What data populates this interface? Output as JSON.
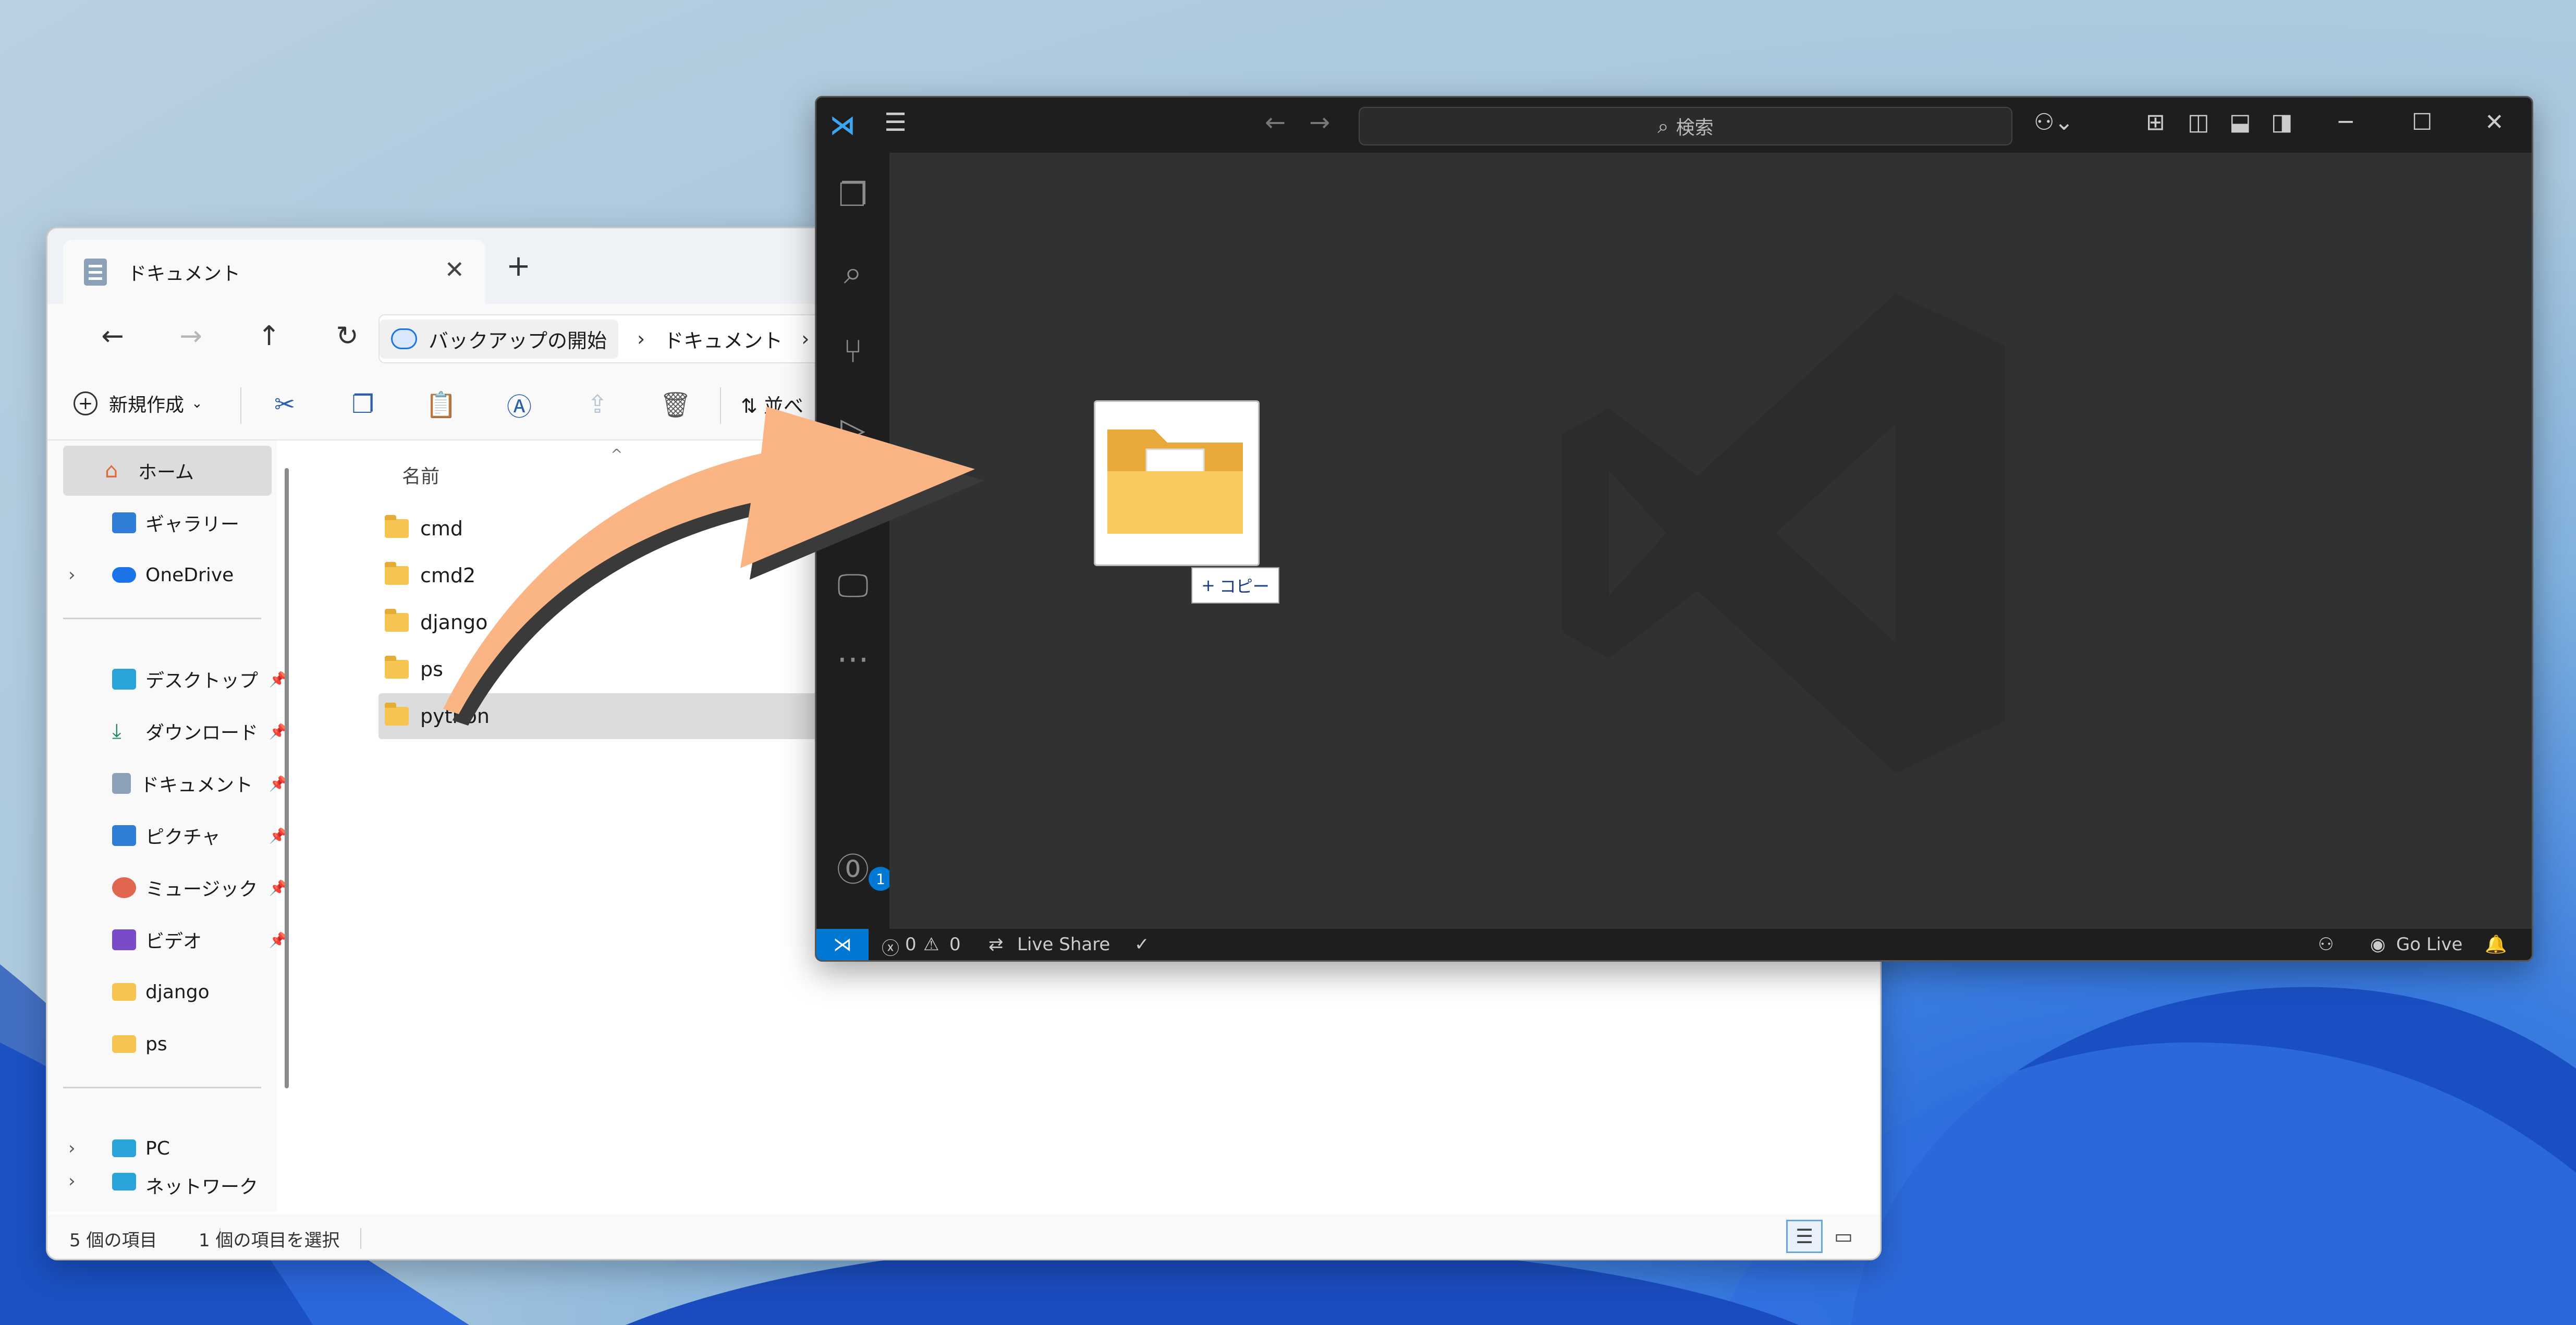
{
  "explorer": {
    "tab_title": "ドキュメント",
    "breadcrumb": {
      "backup": "バックアップの開始",
      "current": "ドキュメント",
      "separator": "›"
    },
    "command_bar": {
      "new_label": "新規作成",
      "sort_label": "並べ"
    },
    "sidebar": {
      "home": "ホーム",
      "gallery": "ギャラリー",
      "onedrive": "OneDrive",
      "quick": [
        "デスクトップ",
        "ダウンロード",
        "ドキュメント",
        "ピクチャ",
        "ミュージック",
        "ビデオ",
        "django",
        "ps"
      ],
      "pc": "PC",
      "network": "ネットワーク"
    },
    "column_name": "名前",
    "files": [
      "cmd",
      "cmd2",
      "django",
      "ps",
      "python"
    ],
    "status": {
      "count": "5 個の項目",
      "selected": "1 個の項目を選択"
    }
  },
  "vscode": {
    "search_placeholder": "検索",
    "account_badge": "1",
    "drag_tooltip": "コピー",
    "status": {
      "errors": "0",
      "warnings": "0",
      "live_share": "Live Share",
      "go_live": "Go Live"
    },
    "accent_color": "#0078d4"
  },
  "colors": {
    "folder": "#f5c451",
    "arrow": "#fbb584"
  }
}
